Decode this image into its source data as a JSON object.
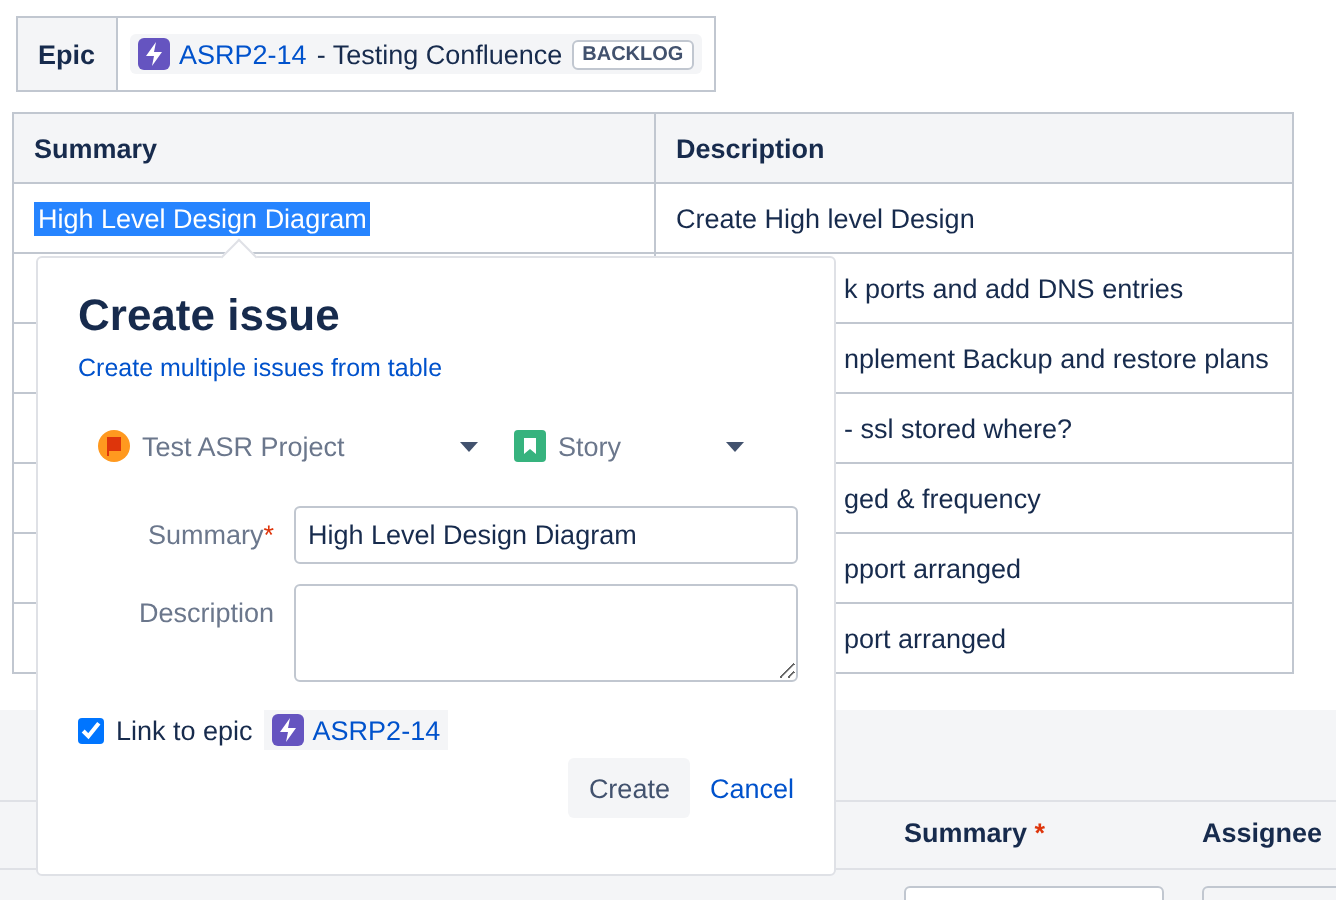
{
  "epic": {
    "label": "Epic",
    "key": "ASRP2-14",
    "title": " - Testing Confluence",
    "status": "BACKLOG"
  },
  "table": {
    "columns": [
      "Summary",
      "Description"
    ],
    "rows": [
      {
        "summary": "High Level Design Diagram",
        "summary_selected": true,
        "description": "Create High level Design"
      },
      {
        "description": "k ports and add DNS entries"
      },
      {
        "description": "nplement Backup and restore plans"
      },
      {
        "description": "- ssl stored where?"
      },
      {
        "description": "ged & frequency"
      },
      {
        "description": "pport arranged"
      },
      {
        "description": "port arranged"
      }
    ]
  },
  "dialog": {
    "title": "Create issue",
    "link": "Create multiple issues from table",
    "project": "Test ASR Project",
    "issue_type": "Story",
    "summary_label": "Summary",
    "summary_mark": "*",
    "summary_value": "High Level Design Diagram",
    "description_label": "Description",
    "link_to_epic": {
      "label": "Link to epic",
      "checked": true,
      "key": "ASRP2-14"
    },
    "buttons": {
      "create": "Create",
      "cancel": "Cancel"
    }
  },
  "bottom_table": {
    "columns": [
      {
        "label": "Summary",
        "mark": "*"
      },
      {
        "label": "Assignee"
      }
    ]
  }
}
